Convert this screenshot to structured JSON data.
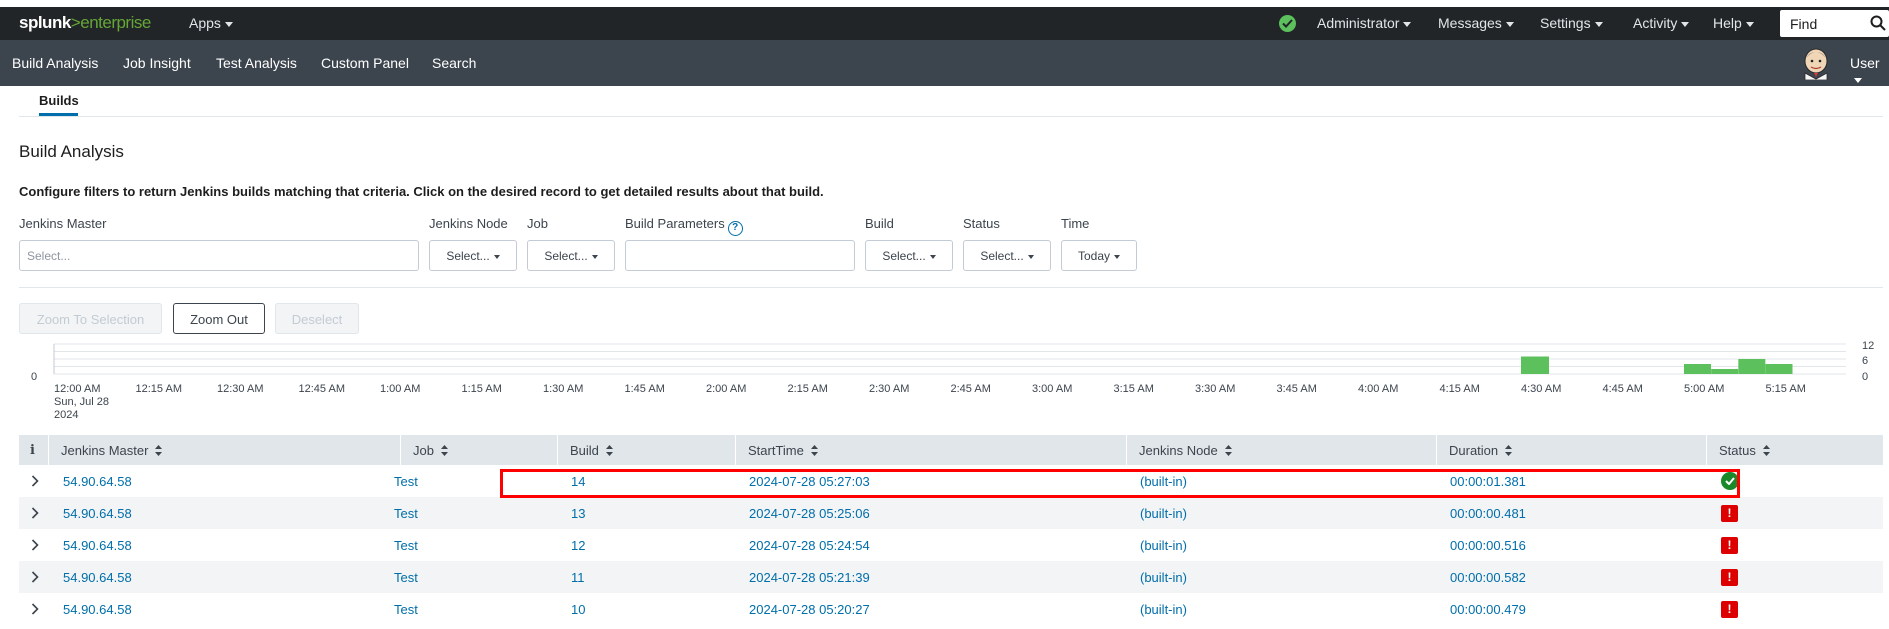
{
  "topbar": {
    "logo_main": "splunk",
    "logo_gt": ">",
    "logo_product": "enterprise",
    "apps_label": "Apps",
    "menus": [
      "Administrator",
      "Messages",
      "Settings",
      "Activity",
      "Help"
    ],
    "find_placeholder": "Find"
  },
  "appbar": {
    "nav": [
      "Build Analysis",
      "Job Insight",
      "Test Analysis",
      "Custom Panel",
      "Search"
    ],
    "user_label": "User"
  },
  "tabs": {
    "active": "Builds"
  },
  "page": {
    "title": "Build Analysis",
    "description": "Configure filters to return Jenkins builds matching that criteria. Click on the desired record to get detailed results about that build."
  },
  "filters": {
    "jenkins_master": {
      "label": "Jenkins Master",
      "placeholder": "Select..."
    },
    "jenkins_node": {
      "label": "Jenkins Node",
      "value": "Select..."
    },
    "job": {
      "label": "Job",
      "value": "Select..."
    },
    "build_parameters": {
      "label": "Build Parameters",
      "value": ""
    },
    "build": {
      "label": "Build",
      "value": "Select..."
    },
    "status": {
      "label": "Status",
      "value": "Select..."
    },
    "time": {
      "label": "Time",
      "value": "Today"
    }
  },
  "buttons": {
    "zoom_to_selection": "Zoom To Selection",
    "zoom_out": "Zoom Out",
    "deselect": "Deselect"
  },
  "timeline": {
    "left_axis_zero": "0",
    "right_axis": [
      "12",
      "6",
      "0"
    ],
    "ticks": [
      "12:00 AM",
      "12:15 AM",
      "12:30 AM",
      "12:45 AM",
      "1:00 AM",
      "1:15 AM",
      "1:30 AM",
      "1:45 AM",
      "2:00 AM",
      "2:15 AM",
      "2:30 AM",
      "2:45 AM",
      "3:00 AM",
      "3:15 AM",
      "3:30 AM",
      "3:45 AM",
      "4:00 AM",
      "4:15 AM",
      "4:30 AM",
      "4:45 AM",
      "5:00 AM",
      "5:15 AM"
    ],
    "first_tick_sub": [
      "Sun, Jul 28",
      "2024"
    ],
    "bar_color": "#5cc05c"
  },
  "chart_data": {
    "type": "bar",
    "x_start": "12:00 AM",
    "interval": "15 min",
    "ylim": [
      0,
      12
    ],
    "bars": [
      {
        "x": "4:30 AM",
        "value": 7
      },
      {
        "x": "5:00 AM",
        "value": 4
      },
      {
        "x": "5:05 AM",
        "value": 2
      },
      {
        "x": "5:10 AM",
        "value": 6
      },
      {
        "x": "5:15 AM",
        "value": 4
      }
    ]
  },
  "table": {
    "columns": [
      "i",
      "Jenkins Master",
      "Job",
      "Build",
      "StartTime",
      "Jenkins Node",
      "Duration",
      "Status"
    ],
    "rows": [
      {
        "master": "54.90.64.58",
        "job": "Test",
        "build": "14",
        "start": "2024-07-28 05:27:03",
        "node": "(built-in)",
        "duration": "00:00:01.381",
        "status": "success"
      },
      {
        "master": "54.90.64.58",
        "job": "Test",
        "build": "13",
        "start": "2024-07-28 05:25:06",
        "node": "(built-in)",
        "duration": "00:00:00.481",
        "status": "failure"
      },
      {
        "master": "54.90.64.58",
        "job": "Test",
        "build": "12",
        "start": "2024-07-28 05:24:54",
        "node": "(built-in)",
        "duration": "00:00:00.516",
        "status": "failure"
      },
      {
        "master": "54.90.64.58",
        "job": "Test",
        "build": "11",
        "start": "2024-07-28 05:21:39",
        "node": "(built-in)",
        "duration": "00:00:00.582",
        "status": "failure"
      },
      {
        "master": "54.90.64.58",
        "job": "Test",
        "build": "10",
        "start": "2024-07-28 05:20:27",
        "node": "(built-in)",
        "duration": "00:00:00.479",
        "status": "failure"
      }
    ],
    "failure_glyph": "!"
  },
  "colors": {
    "link": "#006eaa",
    "success": "#1a8929",
    "failure": "#dc0000",
    "highlight": "#ff0000"
  }
}
